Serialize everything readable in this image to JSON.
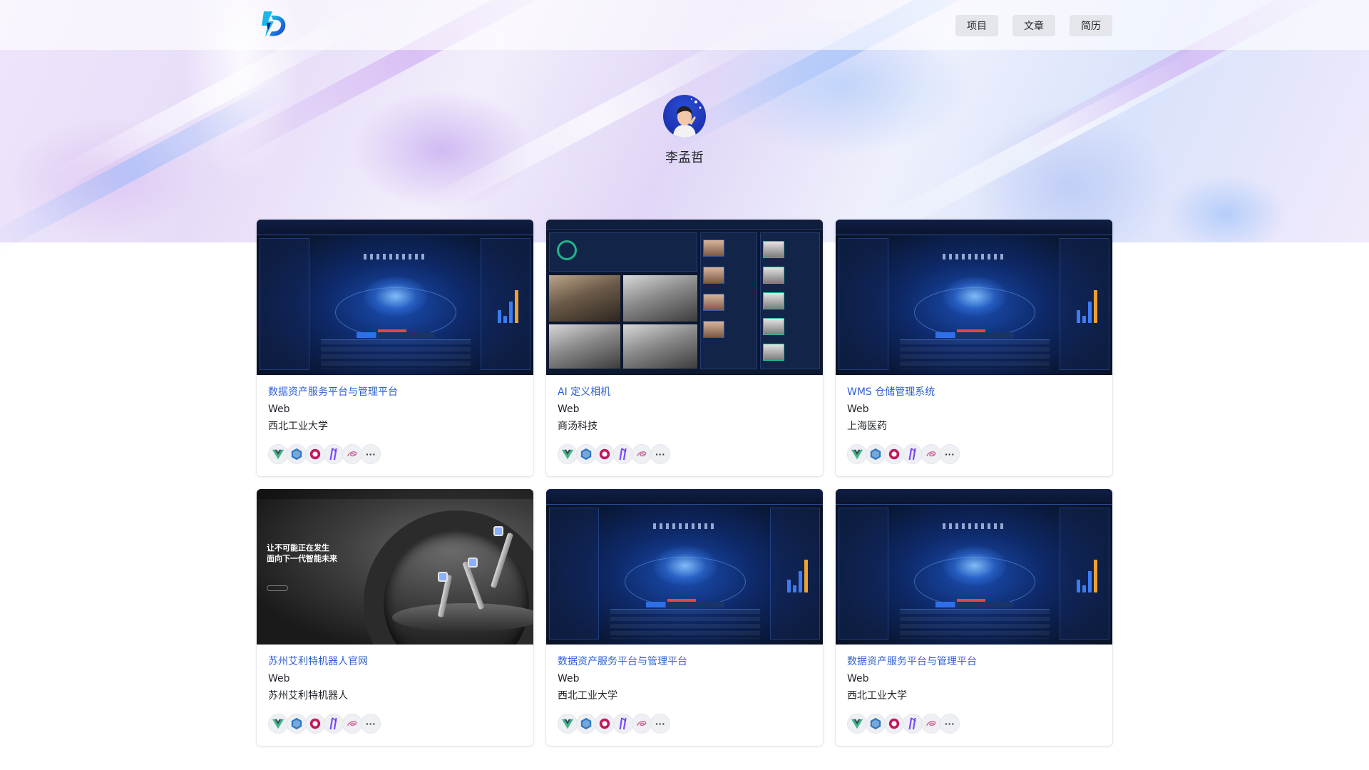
{
  "header": {
    "logo_name": "brand-logo",
    "nav": [
      {
        "label": "项目"
      },
      {
        "label": "文章"
      },
      {
        "label": "简历"
      }
    ]
  },
  "profile": {
    "name": "李孟哲"
  },
  "projects": [
    {
      "title": "数据资产服务平台与管理平台",
      "type": "Web",
      "org": "西北工业大学",
      "thumbnail": "dashboard-screenshot",
      "techs": [
        "vue-icon",
        "typescript-icon",
        "rxjs-icon",
        "vite-icon",
        "sass-icon"
      ],
      "more": "···"
    },
    {
      "title": "AI 定义相机",
      "type": "Web",
      "org": "商汤科技",
      "thumbnail": "ai-camera-screenshot",
      "techs": [
        "vue-icon",
        "typescript-icon",
        "rxjs-icon",
        "vite-icon",
        "sass-icon"
      ],
      "more": "···"
    },
    {
      "title": "WMS 仓储管理系统",
      "type": "Web",
      "org": "上海医药",
      "thumbnail": "dashboard-screenshot",
      "techs": [
        "vue-icon",
        "typescript-icon",
        "rxjs-icon",
        "vite-icon",
        "sass-icon"
      ],
      "more": "···"
    },
    {
      "title": "苏州艾利特机器人官网",
      "type": "Web",
      "org": "苏州艾利特机器人",
      "thumbnail": "robot-site-screenshot",
      "thumb_text": {
        "headline1": "让不可能正在发生",
        "headline2": "面向下一代智能未来"
      },
      "techs": [
        "vue-icon",
        "typescript-icon",
        "rxjs-icon",
        "vite-icon",
        "sass-icon"
      ],
      "more": "···"
    },
    {
      "title": "数据资产服务平台与管理平台",
      "type": "Web",
      "org": "西北工业大学",
      "thumbnail": "dashboard-screenshot",
      "techs": [
        "vue-icon",
        "typescript-icon",
        "rxjs-icon",
        "vite-icon",
        "sass-icon"
      ],
      "more": "···"
    },
    {
      "title": "数据资产服务平台与管理平台",
      "type": "Web",
      "org": "西北工业大学",
      "thumbnail": "dashboard-screenshot",
      "techs": [
        "vue-icon",
        "typescript-icon",
        "rxjs-icon",
        "vite-icon",
        "sass-icon"
      ],
      "more": "···"
    }
  ],
  "colors": {
    "title_link": "#2f5fd6",
    "nav_button_bg": "#e4e6ec",
    "vue_green": "#41b883",
    "vue_dark": "#35495e",
    "ts_blue": "#3178c6",
    "rxjs_red": "#c2185b",
    "vite_purple": "#7c4dff",
    "sass_pink": "#cd6799"
  }
}
